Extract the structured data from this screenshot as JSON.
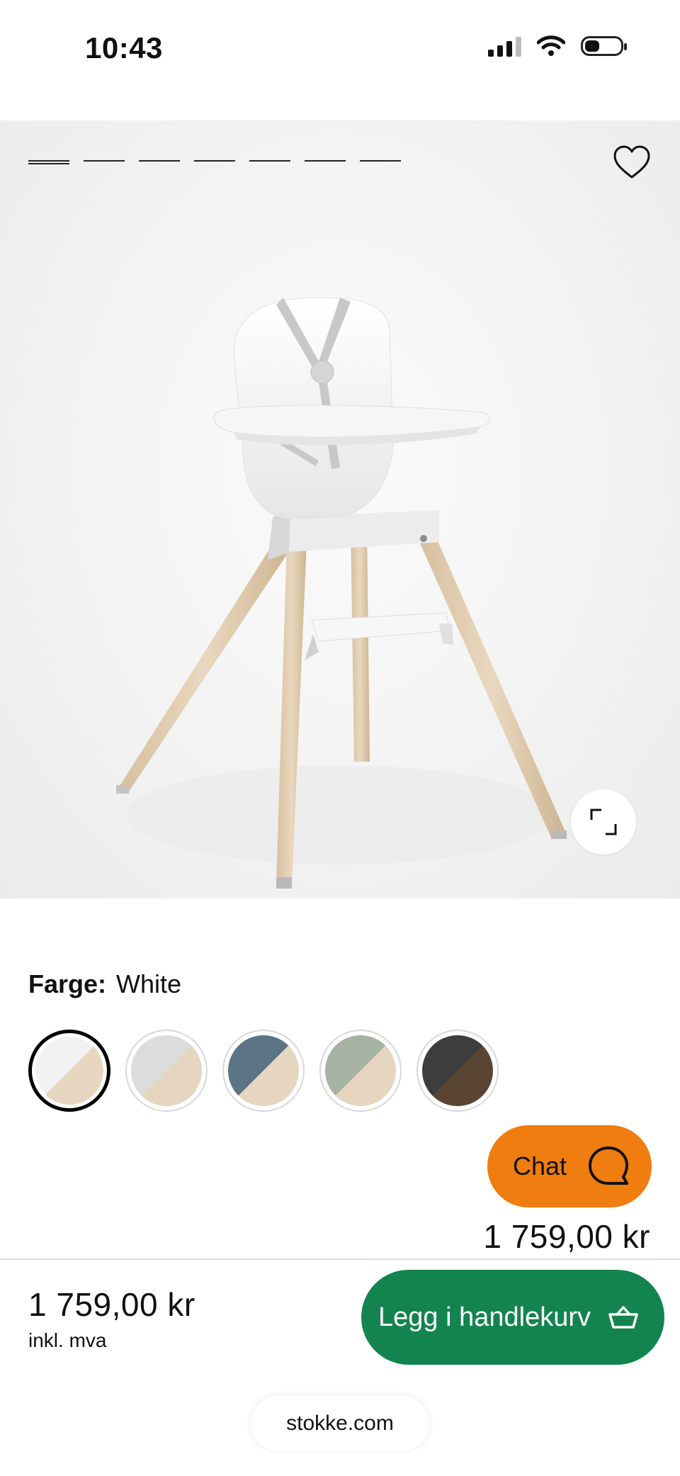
{
  "status_bar": {
    "time": "10:43",
    "battery_level": 0.3
  },
  "gallery": {
    "image_count": 7,
    "active_index": 0,
    "favorite_icon": "heart-outline-icon",
    "expand_icon": "expand-icon"
  },
  "color": {
    "label": "Farge:",
    "selected_name": "White",
    "swatches": [
      {
        "top": "#f2f2f2",
        "bottom": "#e7d6bf"
      },
      {
        "top": "#dcdcdc",
        "bottom": "#e7d6bf"
      },
      {
        "top": "#5b7486",
        "bottom": "#e7d6bf"
      },
      {
        "top": "#a6b3a2",
        "bottom": "#e7d6bf"
      },
      {
        "top": "#3d3d3d",
        "bottom": "#5a4434"
      }
    ]
  },
  "chat": {
    "label": "Chat",
    "icon": "chat-bubble-icon",
    "color": "#ef7d0f"
  },
  "price_floating": "1 759,00 kr",
  "bottom_bar": {
    "price": "1 759,00 kr",
    "vat_note": "inkl. mva",
    "add_to_cart_label": "Legg i handlekurv",
    "cart_icon": "basket-icon",
    "cart_color": "#13844f"
  },
  "browser": {
    "url": "stokke.com"
  }
}
